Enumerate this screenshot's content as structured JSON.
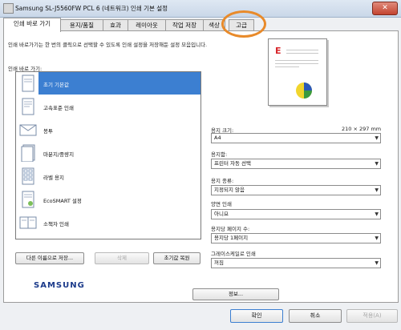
{
  "window": {
    "title": "Samsung SL-J5560FW PCL 6 (네트워크) 인쇄 기본 설정",
    "close_label": "✕"
  },
  "tabs": [
    {
      "label": "인쇄 바로 가기",
      "active": true
    },
    {
      "label": "용지/품질",
      "active": false
    },
    {
      "label": "효과",
      "active": false
    },
    {
      "label": "레이아웃",
      "active": false
    },
    {
      "label": "작업 저장",
      "active": false
    },
    {
      "label": "색상",
      "active": false
    },
    {
      "label": "고급",
      "active": false
    }
  ],
  "shortcuts": {
    "description": "인쇄 바로가기는 한 번의 클릭으로 선택할 수 있도록 인쇄 설정을 저장해둔 설정 모음입니다.",
    "list_label": "인쇄 바로 가기:",
    "items": [
      {
        "label": "초기 기본값",
        "selected": true,
        "icon": "default-page-icon"
      },
      {
        "label": "고속표준 인쇄",
        "selected": false,
        "icon": "fast-print-icon"
      },
      {
        "label": "봉투",
        "selected": false,
        "icon": "envelope-icon"
      },
      {
        "label": "마분지/중량지",
        "selected": false,
        "icon": "cardstock-icon"
      },
      {
        "label": "라벨 용지",
        "selected": false,
        "icon": "label-sheet-icon"
      },
      {
        "label": "EcoSMART 설정",
        "selected": false,
        "icon": "eco-document-icon"
      },
      {
        "label": "소책자 인쇄",
        "selected": false,
        "icon": "booklet-icon"
      }
    ],
    "save_as_label": "다른 이름으로 저장...",
    "delete_label": "삭제",
    "reset_label": "초기값 복원"
  },
  "settings": {
    "paper_size_label": "용지 크기:",
    "paper_size_dims": "210 × 297 mm",
    "paper_size_value": "A4",
    "paper_source_label": "용지함:",
    "paper_source_value": "프린터 자동 선택",
    "paper_type_label": "용지 종류:",
    "paper_type_value": "지정되지 않음",
    "duplex_label": "양면 인쇄",
    "duplex_value": "아니요",
    "pages_per_sheet_label": "용지당 페이지 수:",
    "pages_per_sheet_value": "용지당 1페이지",
    "grayscale_label": "그레이스케일로 인쇄",
    "grayscale_value": "꺼짐",
    "info_label": "정보..."
  },
  "preview": {
    "letter": "E"
  },
  "brand": "SAMSUNG",
  "footer": {
    "ok_label": "확인",
    "cancel_label": "취소",
    "apply_label": "적용(A)"
  },
  "colors": {
    "selection": "#3c7fd1",
    "annotation_ring": "#e88a2a",
    "brand": "#1b3a8a"
  }
}
